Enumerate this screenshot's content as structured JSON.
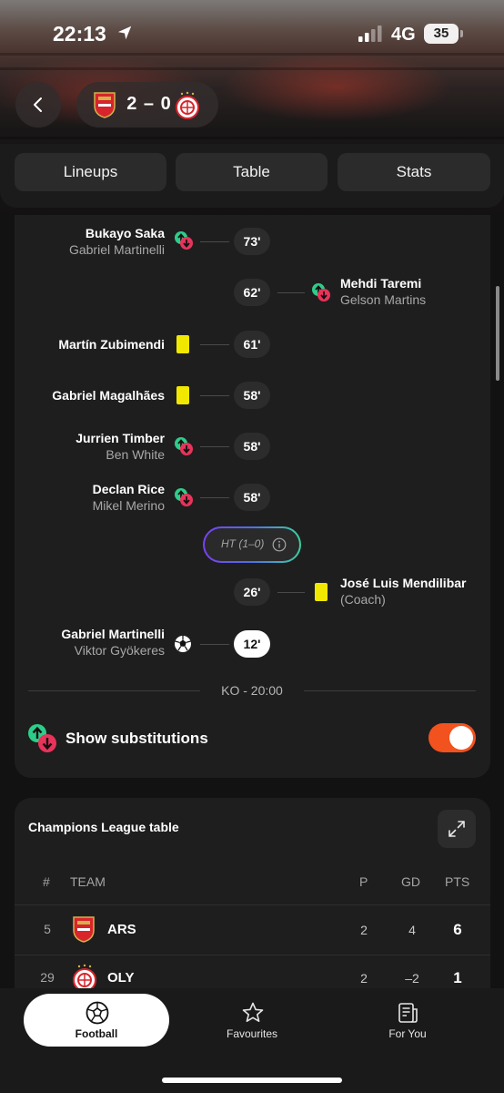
{
  "status_bar": {
    "time": "22:13",
    "network": "4G",
    "battery": "35"
  },
  "match": {
    "score": "2 – 0",
    "home_crest": "arsenal-crest",
    "away_crest": "olympiacos-crest"
  },
  "tabs": [
    {
      "label": "Lineups"
    },
    {
      "label": "Table"
    },
    {
      "label": "Stats"
    }
  ],
  "events": [
    {
      "side": "home",
      "type": "substitution",
      "minute": "73'",
      "player": "Bukayo Saka",
      "sub": "Gabriel Martinelli"
    },
    {
      "side": "away",
      "type": "substitution",
      "minute": "62'",
      "player": "Mehdi Taremi",
      "sub": "Gelson Martins"
    },
    {
      "side": "home",
      "type": "yellow-card",
      "minute": "61'",
      "player": "Martín Zubimendi"
    },
    {
      "side": "home",
      "type": "yellow-card",
      "minute": "58'",
      "player": "Gabriel Magalhães"
    },
    {
      "side": "home",
      "type": "substitution",
      "minute": "58'",
      "player": "Jurrien Timber",
      "sub": "Ben White"
    },
    {
      "side": "home",
      "type": "substitution",
      "minute": "58'",
      "player": "Declan Rice",
      "sub": "Mikel Merino"
    },
    {
      "side": "away",
      "type": "yellow-card",
      "minute": "26'",
      "player": "José Luis Mendilibar",
      "sub": "(Coach)"
    },
    {
      "side": "home",
      "type": "goal",
      "minute": "12'",
      "player": "Gabriel Martinelli",
      "sub": "Viktor Gyökeres"
    }
  ],
  "halftime": {
    "label": "HT (1–0)"
  },
  "kickoff": {
    "label": "KO - 20:00"
  },
  "substitutions_toggle": {
    "label": "Show substitutions",
    "on": true
  },
  "table": {
    "title": "Champions League table",
    "headers": {
      "rank": "#",
      "team": "TEAM",
      "played": "P",
      "gd": "GD",
      "pts": "PTS"
    },
    "rows": [
      {
        "rank": "5",
        "team": "ARS",
        "played": "2",
        "gd": "4",
        "pts": "6"
      },
      {
        "rank": "29",
        "team": "OLY",
        "played": "2",
        "gd": "–2",
        "pts": "1"
      }
    ]
  },
  "nav": [
    {
      "label": "Football",
      "icon": "football-icon",
      "active": true
    },
    {
      "label": "Favourites",
      "icon": "star-icon"
    },
    {
      "label": "For You",
      "icon": "news-icon"
    }
  ],
  "colors": {
    "accent": "#f2521e",
    "yellow_card": "#f0e800",
    "sub_in": "#2ecc8a",
    "sub_out": "#e8335a"
  }
}
